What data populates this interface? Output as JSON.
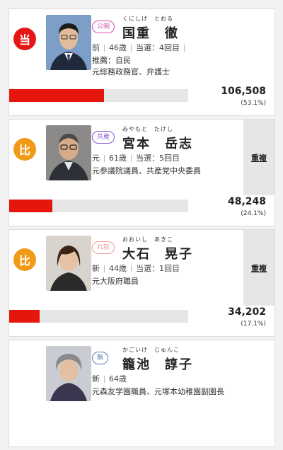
{
  "candidates": [
    {
      "badge": "当",
      "badge_color": "#e51616",
      "party": "公明",
      "party_color": "#d64fb2",
      "kana": "くにしげ　とおる",
      "name": "国重　徹",
      "status": "前",
      "age": "46歳",
      "terms": "当選：4回目",
      "support": "推薦：自民",
      "career": "元総務政務官、弁護士",
      "duplicate": "",
      "votes": "106,508",
      "pct": "(53.1%)",
      "share": 0.531
    },
    {
      "badge": "比",
      "badge_color": "#f09a18",
      "party": "共産",
      "party_color": "#8a55d6",
      "kana": "みやもと　たけし",
      "name": "宮本　岳志",
      "status": "元",
      "age": "61歳",
      "terms": "当選：5回目",
      "support": "",
      "career": "元参議院議員、共産党中央委員",
      "duplicate": "重複",
      "votes": "48,248",
      "pct": "(24.1%)",
      "share": 0.241
    },
    {
      "badge": "比",
      "badge_color": "#f09a18",
      "party": "れ新",
      "party_color": "#f39a9a",
      "kana": "おおいし　あきこ",
      "name": "大石　晃子",
      "status": "新",
      "age": "44歳",
      "terms": "当選：1回目",
      "support": "",
      "career": "元大阪府職員",
      "duplicate": "重複",
      "votes": "34,202",
      "pct": "(17.1%)",
      "share": 0.171
    },
    {
      "badge": "",
      "badge_color": "",
      "party": "無",
      "party_color": "#5a7fb5",
      "kana": "かごいけ　じゅんこ",
      "name": "籠池　諄子",
      "status": "新",
      "age": "64歳",
      "terms": "",
      "support": "",
      "career": "元森友学園職員、元塚本幼稚園副園長",
      "duplicate": "",
      "votes": "",
      "pct": "",
      "share": 0
    }
  ]
}
